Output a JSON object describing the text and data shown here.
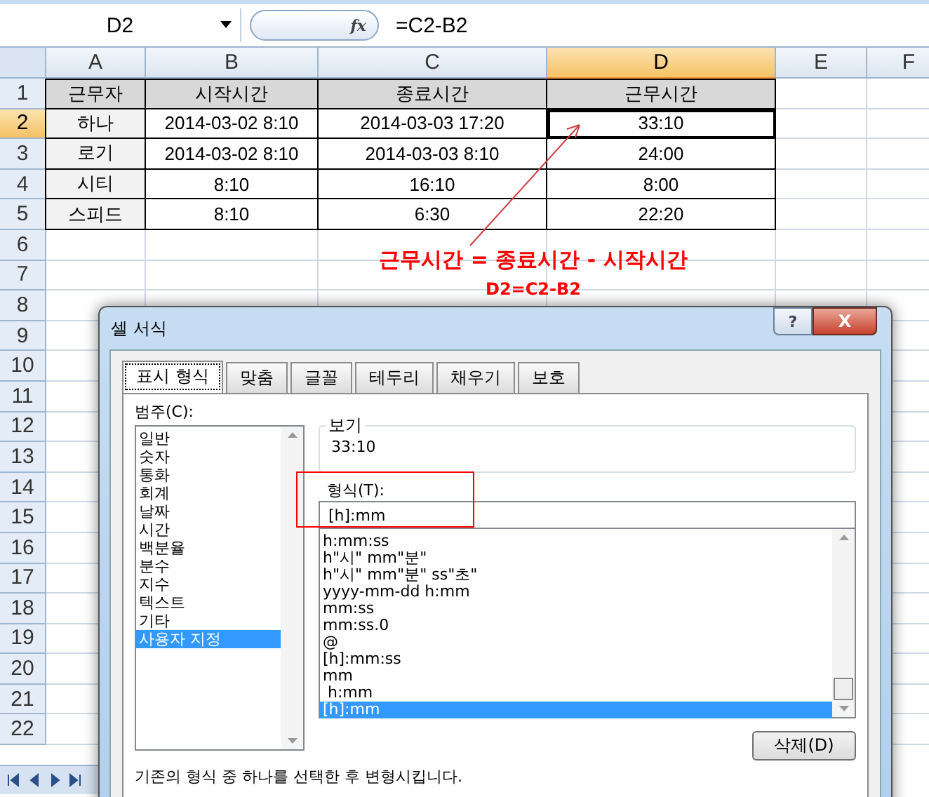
{
  "formula_bar": {
    "name_box": "D2",
    "fx_label": "fx",
    "formula": "=C2-B2"
  },
  "columns": [
    {
      "label": "A",
      "selected": false
    },
    {
      "label": "B",
      "selected": false
    },
    {
      "label": "C",
      "selected": false
    },
    {
      "label": "D",
      "selected": true
    },
    {
      "label": "E",
      "selected": false
    },
    {
      "label": "F",
      "selected": false
    }
  ],
  "rows": [
    {
      "number": "1",
      "selected": false,
      "kind": "header",
      "cells": [
        "근무자",
        "시작시간",
        "종료시간",
        "근무시간"
      ]
    },
    {
      "number": "2",
      "selected": true,
      "kind": "data",
      "cells": [
        "하나",
        "2014-03-02 8:10",
        "2014-03-03 17:20",
        "33:10"
      ]
    },
    {
      "number": "3",
      "selected": false,
      "kind": "data",
      "cells": [
        "로기",
        "2014-03-02 8:10",
        "2014-03-03 8:10",
        "24:00"
      ]
    },
    {
      "number": "4",
      "selected": false,
      "kind": "data",
      "cells": [
        "시티",
        "8:10",
        "16:10",
        "8:00"
      ]
    },
    {
      "number": "5",
      "selected": false,
      "kind": "data",
      "cells": [
        "스피드",
        "8:10",
        "6:30",
        "22:20"
      ]
    },
    {
      "number": "6",
      "selected": false
    },
    {
      "number": "7",
      "selected": false
    },
    {
      "number": "8",
      "selected": false
    },
    {
      "number": "9",
      "selected": false
    },
    {
      "number": "10",
      "selected": false
    },
    {
      "number": "11",
      "selected": false
    },
    {
      "number": "12",
      "selected": false
    },
    {
      "number": "13",
      "selected": false
    },
    {
      "number": "14",
      "selected": false
    },
    {
      "number": "15",
      "selected": false
    },
    {
      "number": "16",
      "selected": false
    },
    {
      "number": "17",
      "selected": false
    },
    {
      "number": "18",
      "selected": false
    },
    {
      "number": "19",
      "selected": false
    },
    {
      "number": "20",
      "selected": false
    },
    {
      "number": "21",
      "selected": false
    },
    {
      "number": "22",
      "selected": false
    }
  ],
  "annotation": {
    "text": "근무시간 = 종료시간 - 시작시간",
    "formula": "D2=C2-B2"
  },
  "dialog": {
    "title": "셀 서식",
    "help": "?",
    "close": "X",
    "tabs": [
      {
        "label": "표시 형식",
        "selected": true
      },
      {
        "label": "맞춤",
        "selected": false
      },
      {
        "label": "글꼴",
        "selected": false
      },
      {
        "label": "테두리",
        "selected": false
      },
      {
        "label": "채우기",
        "selected": false
      },
      {
        "label": "보호",
        "selected": false
      }
    ],
    "category_label": "범주(C):",
    "categories": [
      {
        "label": "일반",
        "selected": false
      },
      {
        "label": "숫자",
        "selected": false
      },
      {
        "label": "통화",
        "selected": false
      },
      {
        "label": "회계",
        "selected": false
      },
      {
        "label": "날짜",
        "selected": false
      },
      {
        "label": "시간",
        "selected": false
      },
      {
        "label": "백분율",
        "selected": false
      },
      {
        "label": "분수",
        "selected": false
      },
      {
        "label": "지수",
        "selected": false
      },
      {
        "label": "텍스트",
        "selected": false
      },
      {
        "label": "기타",
        "selected": false
      },
      {
        "label": "사용자 지정",
        "selected": true
      }
    ],
    "sample_label": "보기",
    "sample_value": "33:10",
    "type_label": "형식(T):",
    "type_value": "[h]:mm",
    "formats": [
      {
        "label": "h:mm:ss",
        "selected": false
      },
      {
        "label": "h\"시\" mm\"분\"",
        "selected": false
      },
      {
        "label": "h\"시\" mm\"분\" ss\"초\"",
        "selected": false
      },
      {
        "label": "yyyy-mm-dd h:mm",
        "selected": false
      },
      {
        "label": "mm:ss",
        "selected": false
      },
      {
        "label": "mm:ss.0",
        "selected": false
      },
      {
        "label": "@",
        "selected": false
      },
      {
        "label": "[h]:mm:ss",
        "selected": false
      },
      {
        "label": "mm",
        "selected": false
      },
      {
        "label": " h:mm",
        "selected": false
      },
      {
        "label": "[h]:mm",
        "selected": true
      }
    ],
    "delete_button": "삭제(D)",
    "description": "기존의 형식 중 하나를 선택한 후 변형시킵니다."
  }
}
